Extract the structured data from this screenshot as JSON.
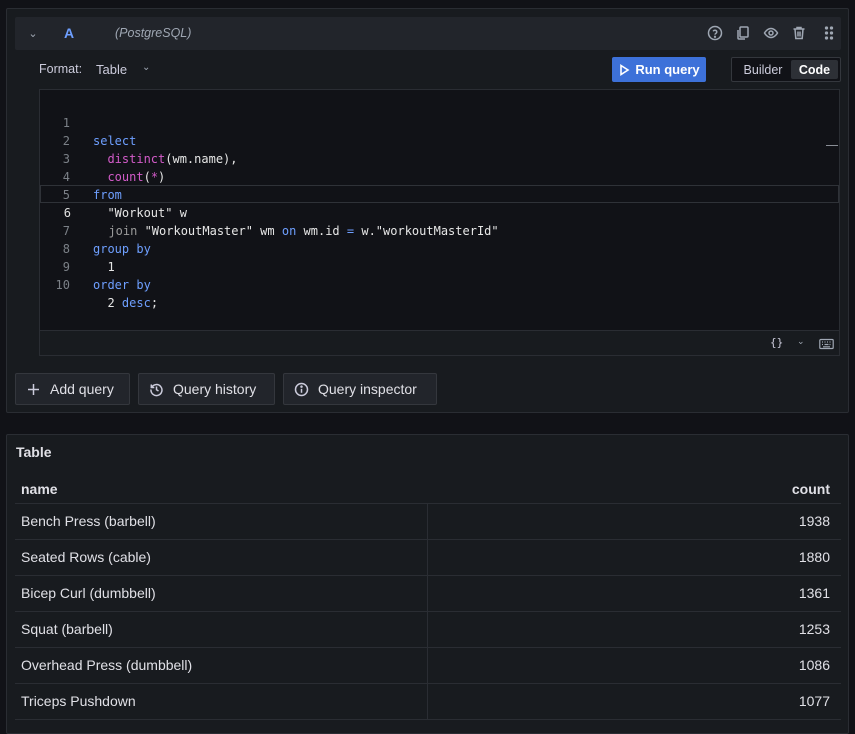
{
  "query": {
    "letter": "A",
    "datasource": "(PostgreSQL)",
    "format_label": "Format:",
    "format_value": "Table",
    "run_label": "Run query",
    "mode_builder": "Builder",
    "mode_code": "Code",
    "header_icons": [
      "help-icon",
      "copy-icon",
      "eye-icon",
      "trash-icon",
      "drag-handle-icon"
    ]
  },
  "editor": {
    "line_numbers": [
      "1",
      "2",
      "3",
      "4",
      "5",
      "6",
      "7",
      "8",
      "9",
      "10"
    ],
    "active_line": 6,
    "footer_braces": "{}"
  },
  "actions": {
    "add_query": "Add query",
    "query_history": "Query history",
    "query_inspector": "Query inspector"
  },
  "table": {
    "title": "Table",
    "columns": [
      "name",
      "count"
    ],
    "rows": [
      {
        "name": "Bench Press (barbell)",
        "count": "1938"
      },
      {
        "name": "Seated Rows (cable)",
        "count": "1880"
      },
      {
        "name": "Bicep Curl (dumbbell)",
        "count": "1361"
      },
      {
        "name": "Squat (barbell)",
        "count": "1253"
      },
      {
        "name": "Overhead Press (dumbbell)",
        "count": "1086"
      },
      {
        "name": "Triceps Pushdown",
        "count": "1077"
      }
    ]
  }
}
